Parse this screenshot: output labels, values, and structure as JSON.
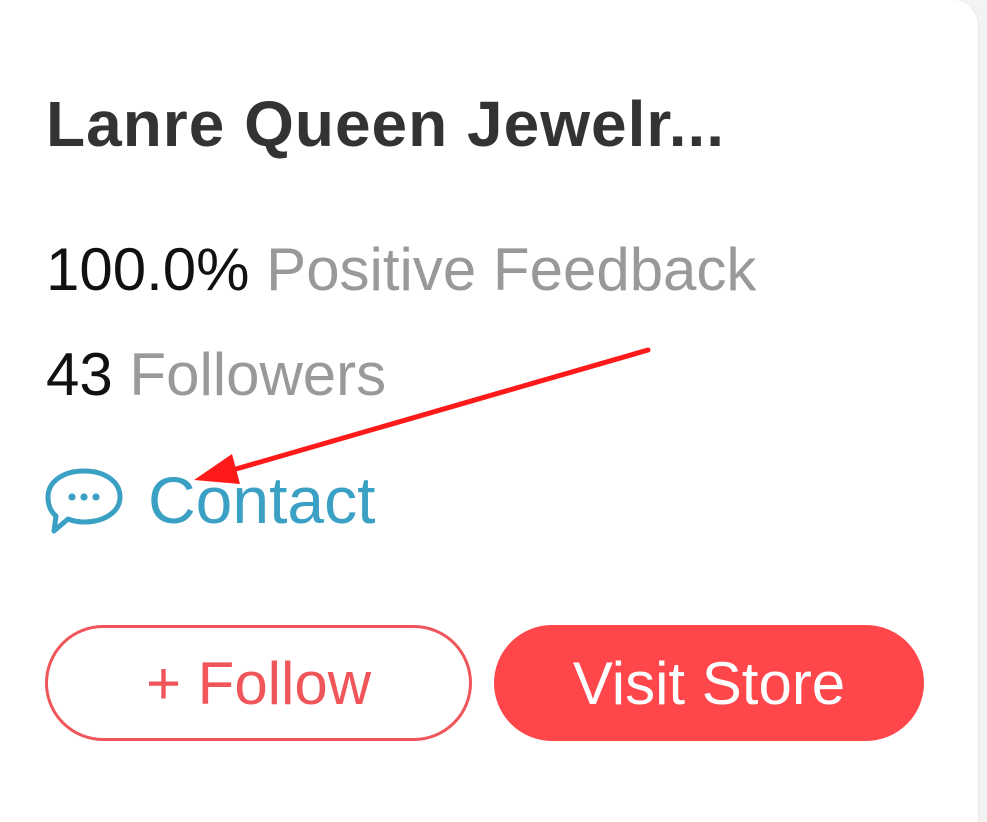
{
  "store": {
    "name": "Lanre Queen Jewelr..."
  },
  "stats": {
    "feedback_value": "100.0%",
    "feedback_label": "Positive Feedback",
    "followers_value": "43",
    "followers_label": "Followers"
  },
  "contact": {
    "label": "Contact",
    "icon": "chat-bubble-icon"
  },
  "buttons": {
    "follow_label": "+ Follow",
    "visit_label": "Visit Store"
  },
  "annotation": {
    "icon": "red-arrow-annotation"
  },
  "colors": {
    "accent_red": "#ff474b",
    "follow_border": "#f0555a",
    "contact_blue": "#3aa0c4",
    "muted_gray": "#999999",
    "annotation_red": "#ff1a1a"
  }
}
